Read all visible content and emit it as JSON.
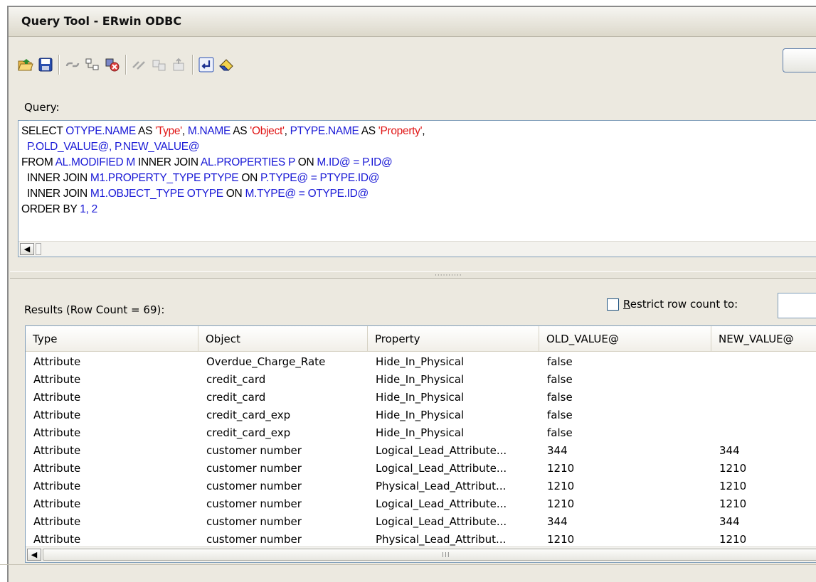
{
  "window": {
    "title": "Query Tool - ERwin ODBC"
  },
  "toolbar": {
    "buttons": [
      {
        "icon": "open-folder-icon"
      },
      {
        "icon": "save-disk-icon"
      },
      {
        "icon": "connect-icon"
      },
      {
        "icon": "network-icon"
      },
      {
        "icon": "disconnect-icon"
      },
      {
        "icon": "link-tables-icon"
      },
      {
        "icon": "copy-tables-icon"
      },
      {
        "icon": "export-tables-icon"
      },
      {
        "icon": "return-arrow-icon"
      },
      {
        "icon": "eraser-icon"
      }
    ]
  },
  "query": {
    "label": "Query:",
    "lines": [
      [
        {
          "t": "SELECT ",
          "c": "kw"
        },
        {
          "t": "OTYPE.NAME",
          "c": "id"
        },
        {
          "t": " AS ",
          "c": "kw"
        },
        {
          "t": "'Type'",
          "c": "str"
        },
        {
          "t": ", ",
          "c": "kw"
        },
        {
          "t": "M.NAME",
          "c": "id"
        },
        {
          "t": " AS ",
          "c": "kw"
        },
        {
          "t": "'Object'",
          "c": "str"
        },
        {
          "t": ", ",
          "c": "kw"
        },
        {
          "t": "PTYPE.NAME",
          "c": "id"
        },
        {
          "t": " AS ",
          "c": "kw"
        },
        {
          "t": "'Property'",
          "c": "str"
        },
        {
          "t": ",",
          "c": "kw"
        }
      ],
      [
        {
          "t": "  P.OLD_VALUE@, P.NEW_VALUE@",
          "c": "id"
        }
      ],
      [
        {
          "t": "FROM ",
          "c": "kw"
        },
        {
          "t": "AL.MODIFIED M",
          "c": "id"
        },
        {
          "t": " INNER JOIN ",
          "c": "kw"
        },
        {
          "t": "AL.PROPERTIES P",
          "c": "id"
        },
        {
          "t": " ON ",
          "c": "kw"
        },
        {
          "t": "M.ID@ = P.ID@",
          "c": "id"
        }
      ],
      [
        {
          "t": "  INNER JOIN ",
          "c": "kw"
        },
        {
          "t": "M1.PROPERTY_TYPE PTYPE",
          "c": "id"
        },
        {
          "t": " ON ",
          "c": "kw"
        },
        {
          "t": "P.TYPE@ = PTYPE.ID@",
          "c": "id"
        }
      ],
      [
        {
          "t": "  INNER JOIN ",
          "c": "kw"
        },
        {
          "t": "M1.OBJECT_TYPE OTYPE",
          "c": "id"
        },
        {
          "t": " ON ",
          "c": "kw"
        },
        {
          "t": "M.TYPE@ = OTYPE.ID@",
          "c": "id"
        }
      ],
      [
        {
          "t": "ORDER BY ",
          "c": "kw"
        },
        {
          "t": "1, 2",
          "c": "id"
        }
      ]
    ]
  },
  "results": {
    "label": "Results (Row Count = 69):",
    "restrict_label_underlined": "R",
    "restrict_label_rest": "estrict row count to:",
    "restrict_checked": false,
    "restrict_value": "",
    "columns": [
      "Type",
      "Object",
      "Property",
      "OLD_VALUE@",
      "NEW_VALUE@"
    ],
    "rows": [
      [
        "Attribute",
        "Overdue_Charge_Rate",
        "Hide_In_Physical",
        "false",
        ""
      ],
      [
        "Attribute",
        "credit_card",
        "Hide_In_Physical",
        "false",
        ""
      ],
      [
        "Attribute",
        "credit_card",
        "Hide_In_Physical",
        "false",
        ""
      ],
      [
        "Attribute",
        "credit_card_exp",
        "Hide_In_Physical",
        "false",
        ""
      ],
      [
        "Attribute",
        "credit_card_exp",
        "Hide_In_Physical",
        "false",
        ""
      ],
      [
        "Attribute",
        "customer number",
        "Logical_Lead_Attribute...",
        "344",
        "344"
      ],
      [
        "Attribute",
        "customer number",
        "Logical_Lead_Attribute...",
        "1210",
        "1210"
      ],
      [
        "Attribute",
        "customer number",
        "Physical_Lead_Attribut...",
        "1210",
        "1210"
      ],
      [
        "Attribute",
        "customer number",
        "Logical_Lead_Attribute...",
        "1210",
        "1210"
      ],
      [
        "Attribute",
        "customer number",
        "Logical_Lead_Attribute...",
        "344",
        "344"
      ],
      [
        "Attribute",
        "customer number",
        "Physical_Lead_Attribut...",
        "1210",
        "1210"
      ]
    ]
  }
}
